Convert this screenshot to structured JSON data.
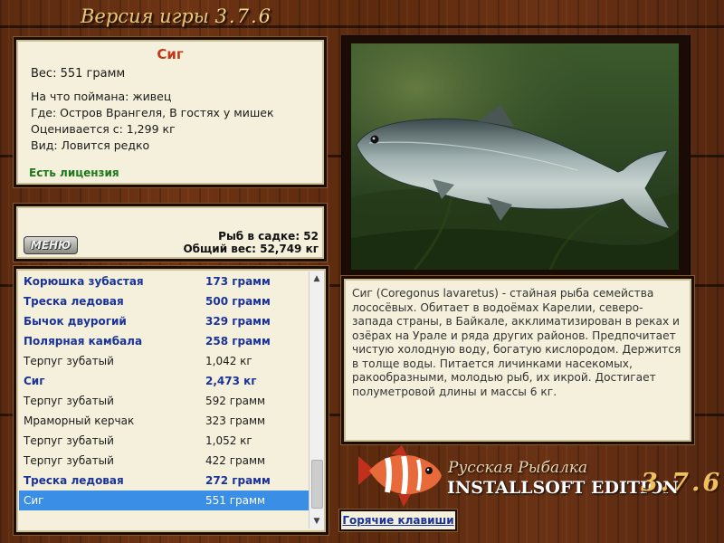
{
  "header": {
    "title_prefix": "Версия игры",
    "version": "3.7.6"
  },
  "fish": {
    "name": "Сиг",
    "weight": "Вес: 551 грамм",
    "details": [
      "На что поймана: живец",
      "Где: Остров Врангеля, В гостях у мишек",
      "Оценивается с: 1,299 кг",
      "Вид: Ловится редко"
    ],
    "license": "Есть лицензия"
  },
  "menu": {
    "button_label": "МЕНЮ",
    "fish_count": "Рыб в садке: 52",
    "total_weight": "Общий вес: 52,749 кг"
  },
  "catch_list": [
    {
      "name": "Корюшка зубастая",
      "weight": "173 грамм",
      "style": "bold"
    },
    {
      "name": "Треска ледовая",
      "weight": "500 грамм",
      "style": "bold"
    },
    {
      "name": "Бычок двурогий",
      "weight": "329 грамм",
      "style": "bold"
    },
    {
      "name": "Полярная камбала",
      "weight": "258 грамм",
      "style": "bold"
    },
    {
      "name": "Терпуг зубатый",
      "weight": "1,042 кг",
      "style": "normal"
    },
    {
      "name": "Сиг",
      "weight": "2,473 кг",
      "style": "bold"
    },
    {
      "name": "Терпуг зубатый",
      "weight": "592 грамм",
      "style": "normal"
    },
    {
      "name": "Мраморный керчак",
      "weight": "323 грамм",
      "style": "normal"
    },
    {
      "name": "Терпуг зубатый",
      "weight": "1,052 кг",
      "style": "normal"
    },
    {
      "name": "Терпуг зубатый",
      "weight": "422 грамм",
      "style": "normal"
    },
    {
      "name": "Треска ледовая",
      "weight": "272 грамм",
      "style": "bold"
    },
    {
      "name": "Сиг",
      "weight": "551 грамм",
      "style": "selected"
    }
  ],
  "description": "Сиг (Coregonus lavaretus) - стайная рыба семейства лососёвых. Обитает в водоёмах Карелии, северо-запада страны, в Байкале, акклиматизирован в реках и озёрах на Урале и ряда других районов. Предпочитает чистую холодную воду, богатую кислородом. Держится в толще воды. Питается личинками насекомых, ракообразными, молодью рыб, их икрой. Достигает полуметровой длины и массы 6 кг.",
  "logo": {
    "line1": "Русская Рыбалка",
    "line2": "INSTALLSOFT EDITION",
    "version": "3.7.6"
  },
  "hotkeys_label": "Горячие клавиши"
}
